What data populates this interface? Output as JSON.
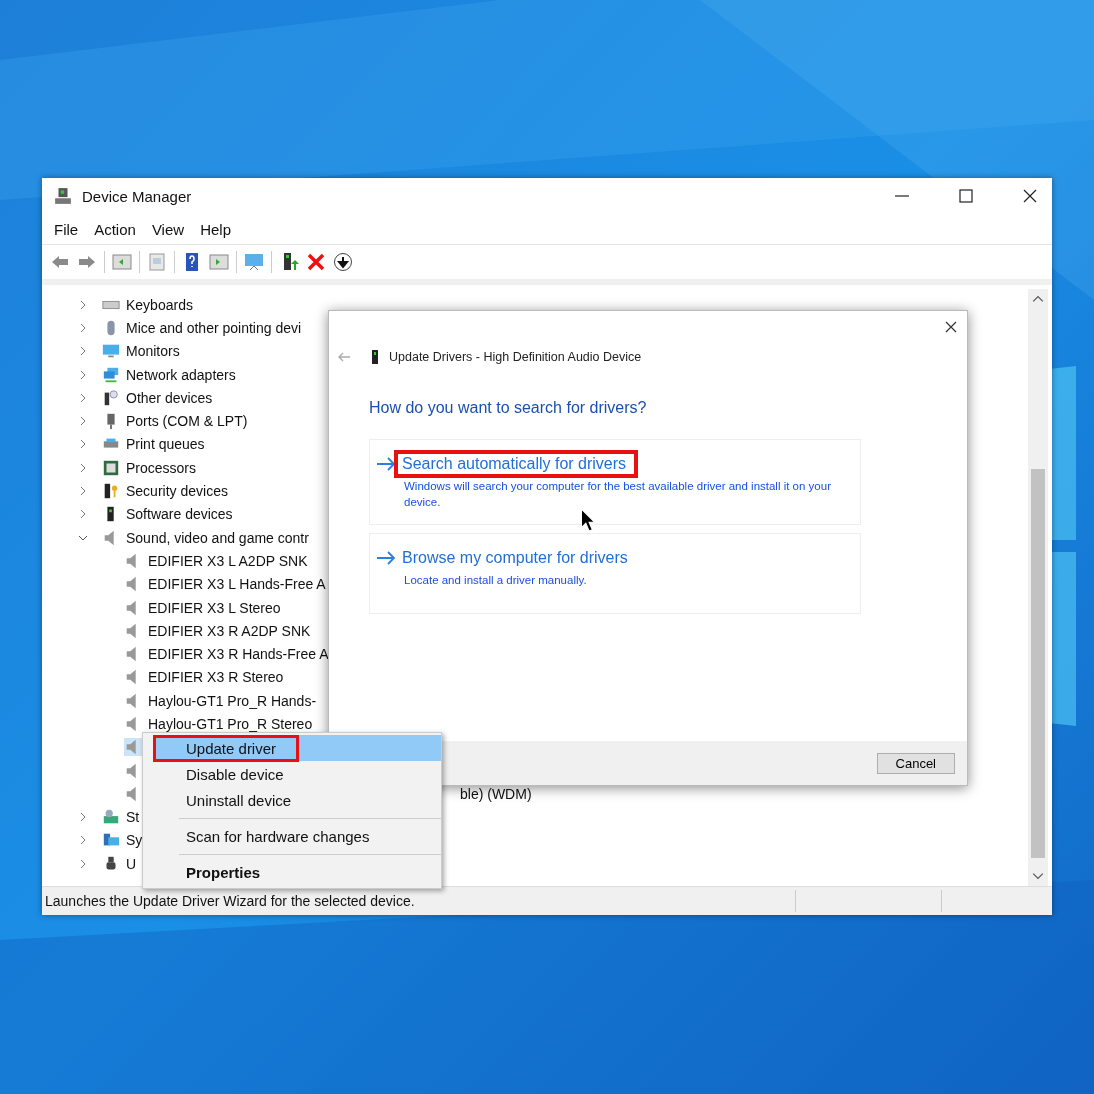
{
  "window": {
    "title": "Device Manager"
  },
  "menu": [
    "File",
    "Action",
    "View",
    "Help"
  ],
  "toolbar": [
    {
      "kind": "back"
    },
    {
      "kind": "forward"
    },
    {
      "kind": "sep"
    },
    {
      "kind": "pane"
    },
    {
      "kind": "sep"
    },
    {
      "kind": "properties"
    },
    {
      "kind": "sep"
    },
    {
      "kind": "help"
    },
    {
      "kind": "pane2"
    },
    {
      "kind": "sep"
    },
    {
      "kind": "scan"
    },
    {
      "kind": "sep"
    },
    {
      "kind": "update"
    },
    {
      "kind": "remove"
    },
    {
      "kind": "download"
    }
  ],
  "tree": [
    {
      "label": "Keyboards",
      "kind": "keyboard",
      "expanded": false
    },
    {
      "label": "Mice and other pointing devi",
      "kind": "mouse",
      "expanded": false
    },
    {
      "label": "Monitors",
      "kind": "monitor",
      "expanded": false
    },
    {
      "label": "Network adapters",
      "kind": "network",
      "expanded": false
    },
    {
      "label": "Other devices",
      "kind": "other",
      "expanded": false
    },
    {
      "label": "Ports (COM & LPT)",
      "kind": "port",
      "expanded": false
    },
    {
      "label": "Print queues",
      "kind": "printer",
      "expanded": false
    },
    {
      "label": "Processors",
      "kind": "processor",
      "expanded": false
    },
    {
      "label": "Security devices",
      "kind": "security",
      "expanded": false
    },
    {
      "label": "Software devices",
      "kind": "software",
      "expanded": false
    },
    {
      "label": "Sound, video and game contr",
      "kind": "speaker",
      "expanded": true,
      "children": [
        {
          "label": "EDIFIER X3 L A2DP SNK",
          "selected": false
        },
        {
          "label": "EDIFIER X3 L Hands-Free A",
          "selected": false
        },
        {
          "label": "EDIFIER X3 L Stereo",
          "selected": false
        },
        {
          "label": "EDIFIER X3 R A2DP SNK",
          "selected": false
        },
        {
          "label": "EDIFIER X3 R Hands-Free A",
          "selected": false
        },
        {
          "label": "EDIFIER X3 R Stereo",
          "selected": false
        },
        {
          "label": "Haylou-GT1 Pro_R Hands-",
          "selected": false
        },
        {
          "label": "Haylou-GT1 Pro_R Stereo",
          "selected": false
        },
        {
          "selected": true
        },
        {
          "selected": false
        },
        {
          "label": "ble) (WDM)",
          "selected": false,
          "covered": true
        }
      ]
    },
    {
      "label": "St",
      "kind": "storage",
      "expanded": false
    },
    {
      "label": "Sy",
      "kind": "system",
      "expanded": false
    },
    {
      "label": "U",
      "kind": "usb",
      "expanded": false
    }
  ],
  "status_bar": "Launches the Update Driver Wizard for the selected device.",
  "dialog": {
    "title": "Update Drivers - High Definition Audio Device",
    "question": "How do you want to search for drivers?",
    "options": [
      {
        "title": "Search automatically for drivers",
        "description": "Windows will search your computer for the best available driver and install it on your device.",
        "highlighted": true
      },
      {
        "title": "Browse my computer for drivers",
        "description": "Locate and install a driver manually.",
        "highlighted": false
      }
    ],
    "cancel": "Cancel"
  },
  "context_menu": [
    {
      "label": "Update driver",
      "selected": true,
      "highlighted": true,
      "bold": false,
      "separator_before": false
    },
    {
      "label": "Disable device",
      "selected": false,
      "highlighted": false,
      "bold": false,
      "separator_before": false
    },
    {
      "label": "Uninstall device",
      "selected": false,
      "highlighted": false,
      "bold": false,
      "separator_before": false
    },
    {
      "label": "Scan for hardware changes",
      "selected": false,
      "highlighted": false,
      "bold": false,
      "separator_before": true
    },
    {
      "label": "Properties",
      "selected": false,
      "highlighted": false,
      "bold": true,
      "separator_before": true
    }
  ]
}
